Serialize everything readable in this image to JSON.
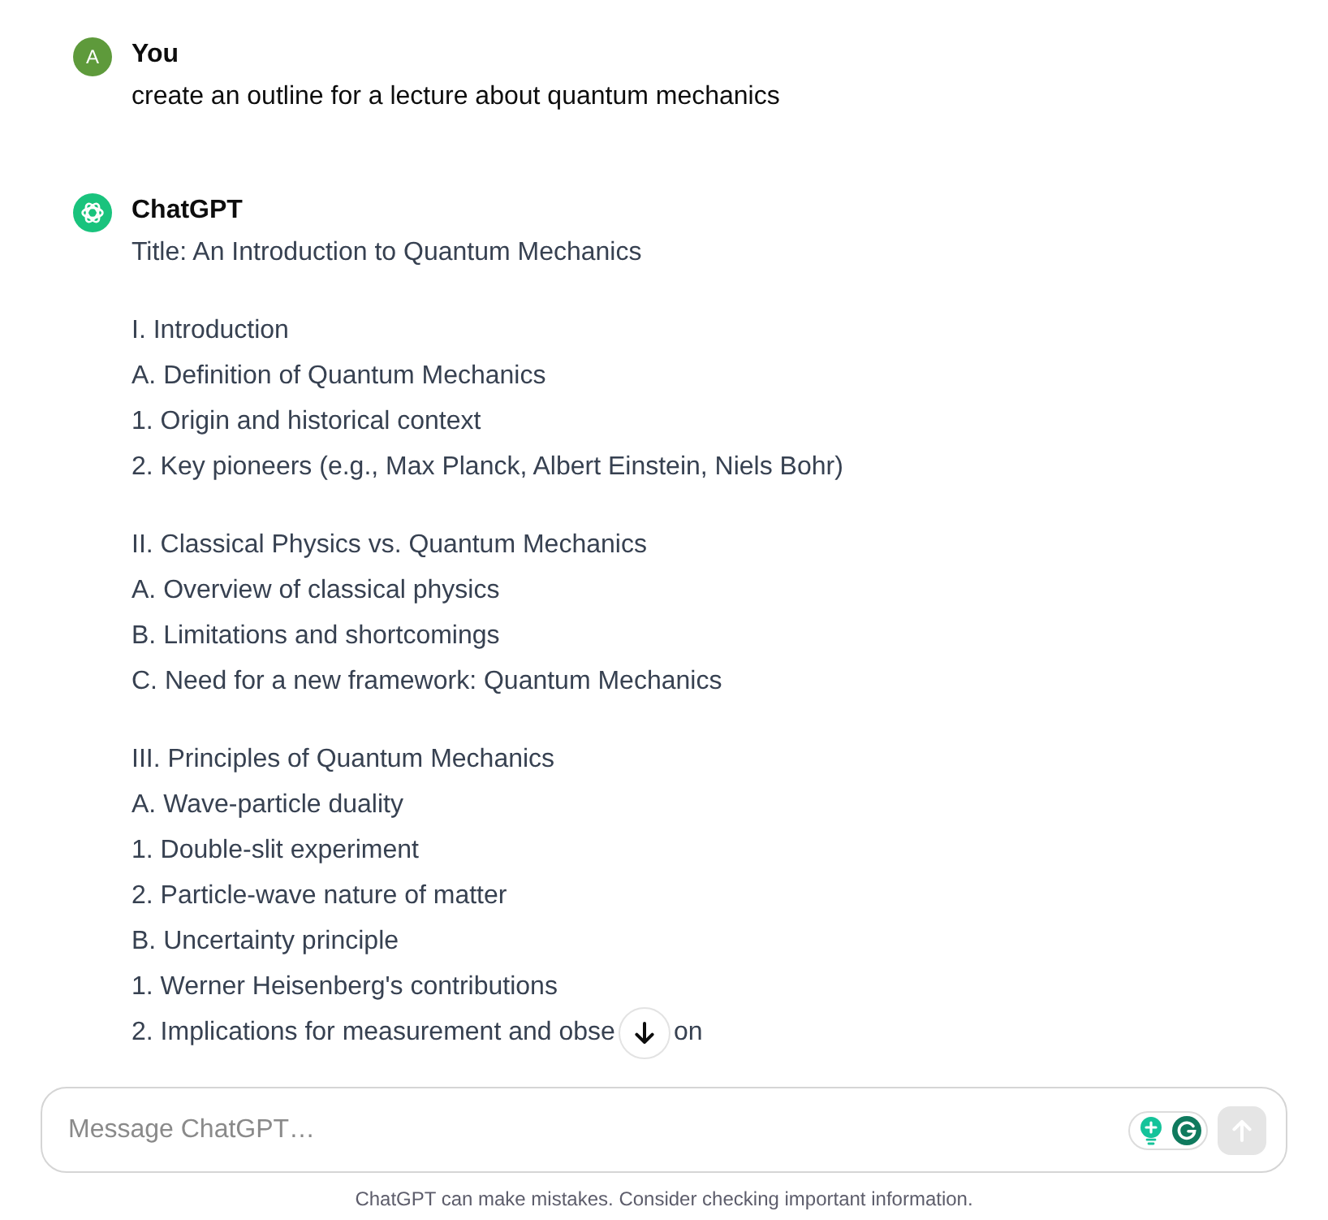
{
  "messages": [
    {
      "kind": "user",
      "avatar": "A",
      "author": "You",
      "paragraphs": [
        [
          "create an outline for a lecture about quantum mechanics"
        ]
      ]
    },
    {
      "kind": "assistant",
      "author": "ChatGPT",
      "paragraphs": [
        [
          "Title: An Introduction to Quantum Mechanics"
        ],
        [
          "I. Introduction",
          "A. Definition of Quantum Mechanics",
          "1. Origin and historical context",
          "2. Key pioneers (e.g., Max Planck, Albert Einstein, Niels Bohr)"
        ],
        [
          "II. Classical Physics vs. Quantum Mechanics",
          "A. Overview of classical physics",
          "B. Limitations and shortcomings",
          "C. Need for a new framework: Quantum Mechanics"
        ],
        [
          "III. Principles of Quantum Mechanics",
          "A. Wave-particle duality",
          "1. Double-slit experiment",
          "2. Particle-wave nature of matter",
          "B. Uncertainty principle",
          "1. Werner Heisenberg's contributions",
          {
            "kind": "covered",
            "parts": [
              "2. Implications for measurement and obse",
              "on"
            ]
          }
        ]
      ]
    }
  ],
  "composer": {
    "placeholder": "Message ChatGPT…",
    "send_button": {
      "disabled": true
    }
  },
  "disclaimer": "ChatGPT can make mistakes. Consider checking important information."
}
